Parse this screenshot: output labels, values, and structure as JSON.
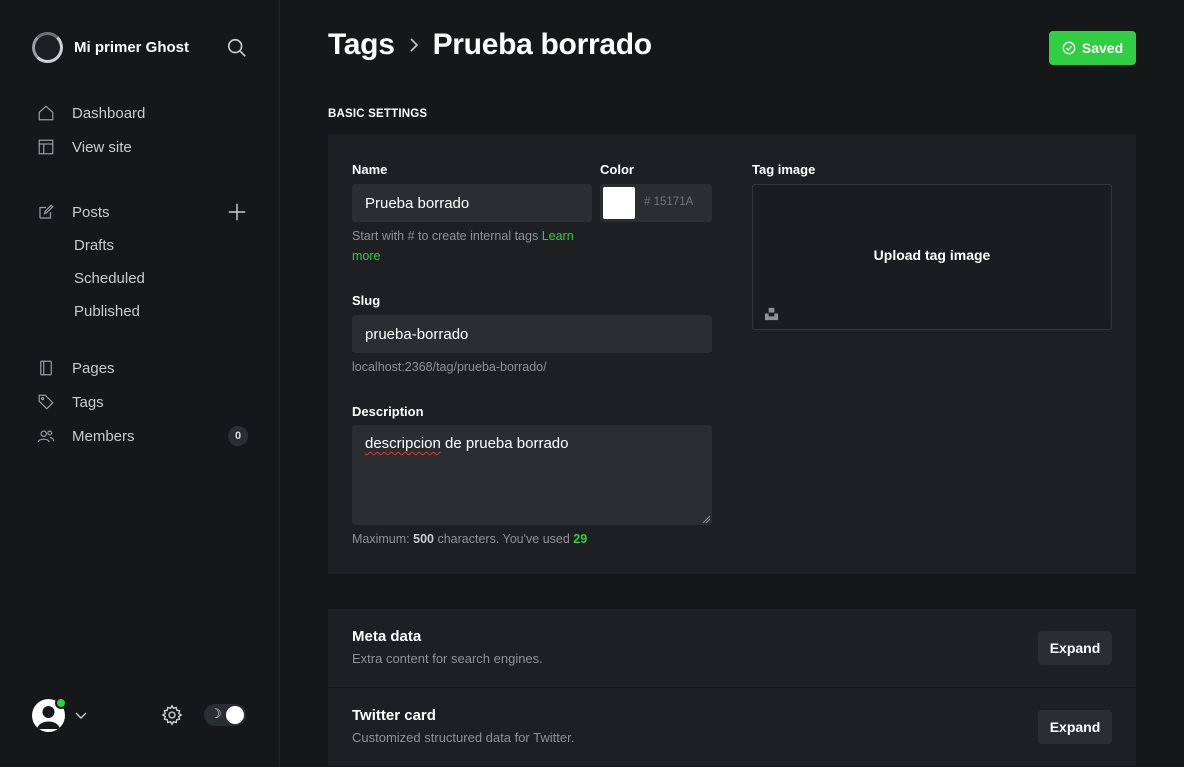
{
  "sidebar": {
    "site_title": "Mi primer Ghost",
    "nav": [
      {
        "label": "Dashboard",
        "icon": "home-icon"
      },
      {
        "label": "View site",
        "icon": "layout-icon"
      }
    ],
    "posts": {
      "label": "Posts",
      "icon": "edit-icon",
      "subitems": [
        "Drafts",
        "Scheduled",
        "Published"
      ]
    },
    "nav2": [
      {
        "label": "Pages",
        "icon": "page-icon"
      },
      {
        "label": "Tags",
        "icon": "tag-icon"
      },
      {
        "label": "Members",
        "icon": "members-icon",
        "badge": "0"
      }
    ]
  },
  "header": {
    "crumb_parent": "Tags",
    "crumb_current": "Prueba borrado",
    "saved_label": "Saved"
  },
  "basic": {
    "section_title": "BASIC SETTINGS",
    "name_label": "Name",
    "name_value": "Prueba borrado",
    "name_hint": "Start with # to create internal tags",
    "learn_more": "Learn more",
    "color_label": "Color",
    "color_hash": "#",
    "color_placeholder": "15171A",
    "tag_image_label": "Tag image",
    "upload_label": "Upload tag image",
    "slug_label": "Slug",
    "slug_value": "prueba-borrado",
    "slug_url": "localhost:2368/tag/prueba-borrado/",
    "desc_label": "Description",
    "desc_word1": "descripcion",
    "desc_rest": " de prueba borrado",
    "desc_hint_prefix": "Maximum: ",
    "desc_max": "500",
    "desc_hint_mid": " characters. You've used ",
    "desc_used": "29"
  },
  "cards": [
    {
      "title": "Meta data",
      "subtitle": "Extra content for search engines.",
      "button": "Expand"
    },
    {
      "title": "Twitter card",
      "subtitle": "Customized structured data for Twitter.",
      "button": "Expand"
    }
  ],
  "colors": {
    "accent": "#30cf43",
    "background": "#151719",
    "panel": "#1d1f22",
    "input": "#2b2d31"
  }
}
